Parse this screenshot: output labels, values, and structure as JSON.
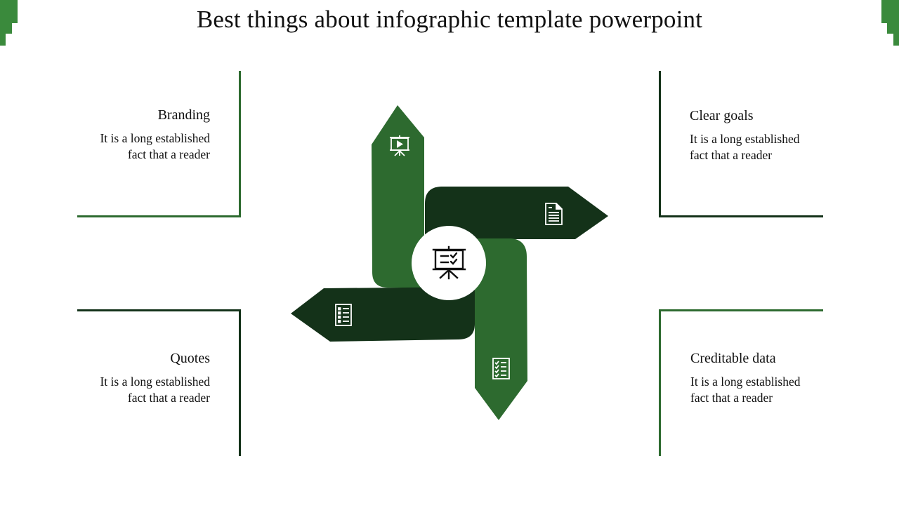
{
  "title": "Best things about infographic template powerpoint",
  "colors": {
    "accent_green": "#2d6a2f",
    "dark_green": "#143219",
    "corner_green": "#3a8a3c",
    "background": "#ffffff"
  },
  "center": {
    "icon": "presentation-board-checklist-icon"
  },
  "arrows": [
    {
      "direction": "up",
      "color": "accent_green",
      "icon": "presentation-play-icon"
    },
    {
      "direction": "right",
      "color": "dark_green",
      "icon": "document-icon"
    },
    {
      "direction": "down",
      "color": "accent_green",
      "icon": "checklist-icon"
    },
    {
      "direction": "left",
      "color": "dark_green",
      "icon": "bulleted-list-icon"
    }
  ],
  "items": [
    {
      "heading": "Branding",
      "line1": "It is a long established",
      "line2": "fact that a reader"
    },
    {
      "heading": "Clear goals",
      "line1": "It is a long established",
      "line2": "fact that a reader"
    },
    {
      "heading": "Quotes",
      "line1": "It is a long established",
      "line2": "fact that a reader"
    },
    {
      "heading": "Creditable data",
      "line1": "It is a long established",
      "line2": "fact that a reader"
    }
  ]
}
